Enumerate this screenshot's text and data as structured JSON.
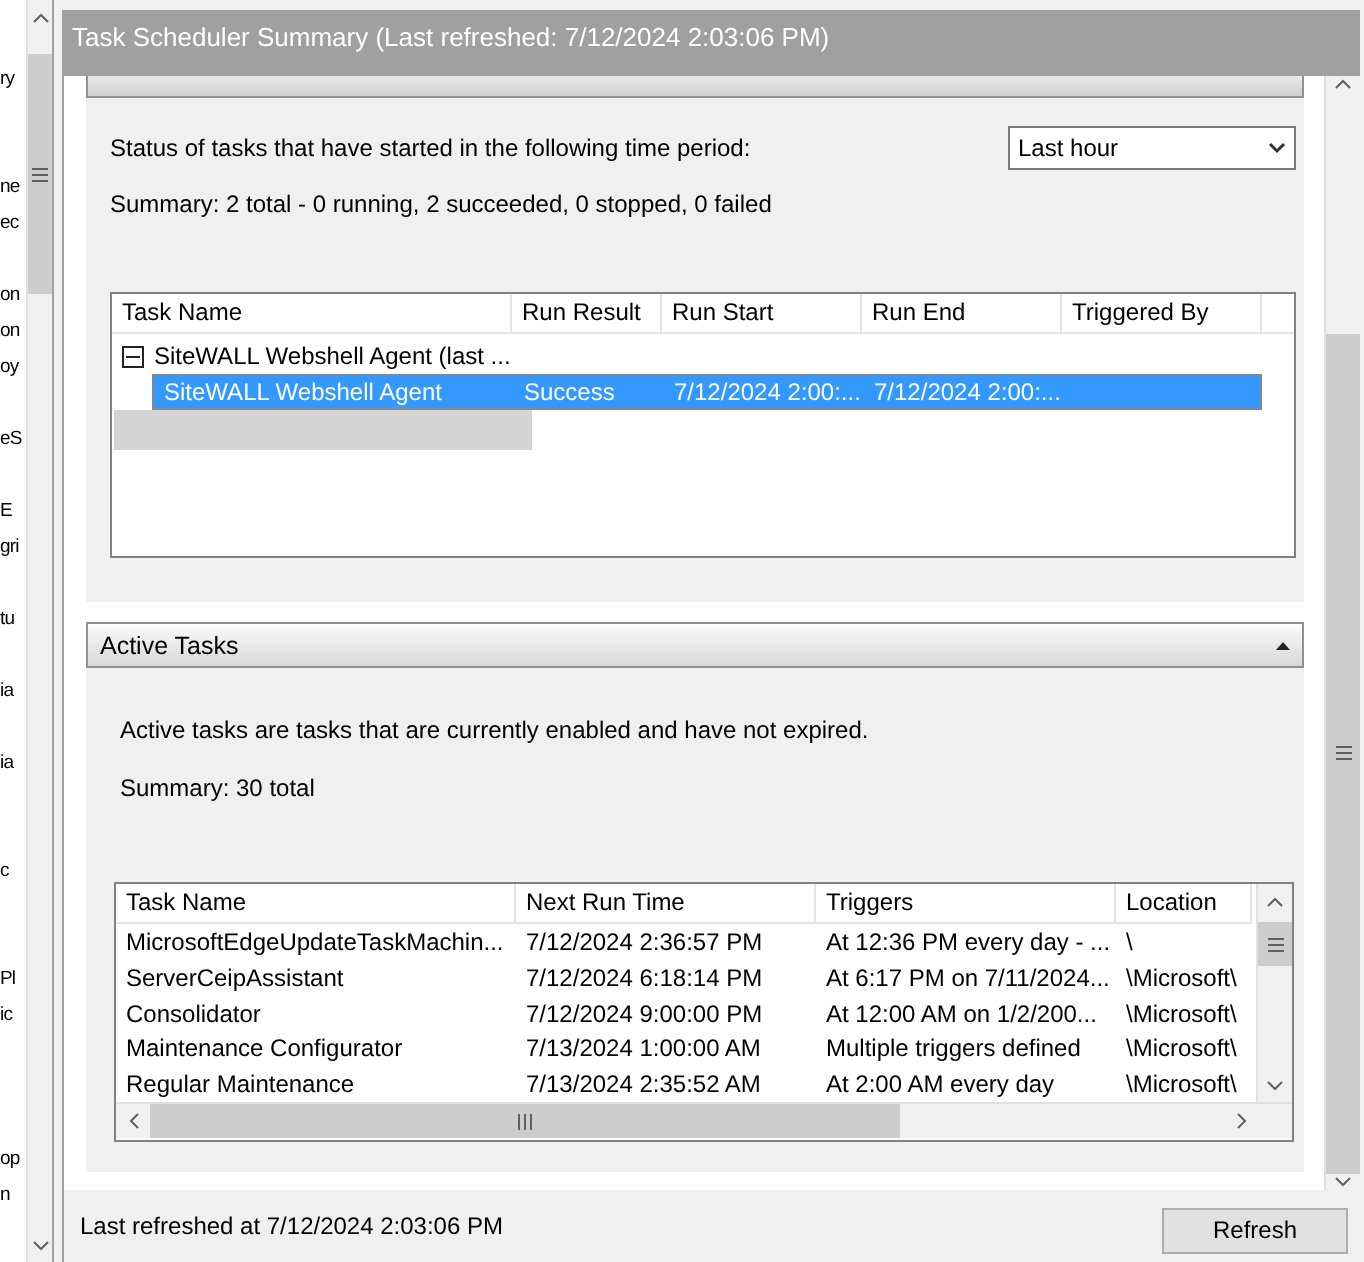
{
  "left_pane": {
    "fragments": [
      "ry",
      "ne",
      "ec",
      "on",
      "on",
      "oy",
      "eS",
      "E",
      "gri",
      "tu",
      "ia",
      "ia",
      "c",
      "Pl",
      "ic",
      "op",
      "n"
    ]
  },
  "panel": {
    "title": "Task Scheduler Summary (Last refreshed: 7/12/2024 2:03:06 PM)"
  },
  "task_status": {
    "prompt": "Status of tasks that have started in the following time period:",
    "period": "Last hour",
    "summary": "Summary: 2 total - 0 running, 2 succeeded, 0 stopped, 0 failed",
    "table": {
      "columns": [
        "Task Name",
        "Run Result",
        "Run Start",
        "Run End",
        "Triggered By"
      ],
      "groups": [
        {
          "label": "SiteWALL Webshell Agent (last ...",
          "expanded": true,
          "rows": [
            {
              "cells": [
                "SiteWALL Webshell Agent",
                "Success",
                "7/12/2024 2:00:...",
                "7/12/2024 2:00:..."
              ],
              "selected": true
            }
          ]
        }
      ]
    }
  },
  "active_tasks": {
    "title": "Active Tasks",
    "expanded": true,
    "description": "Active tasks are tasks that are currently enabled and have not expired.",
    "summary": "Summary: 30 total",
    "table": {
      "columns": [
        "Task Name",
        "Next Run Time",
        "Triggers",
        "Location"
      ],
      "rows": [
        [
          "MicrosoftEdgeUpdateTaskMachin...",
          "7/12/2024 2:36:57 PM",
          "At 12:36 PM every day - ...",
          "\\"
        ],
        [
          "ServerCeipAssistant",
          "7/12/2024 6:18:14 PM",
          "At 6:17 PM on 7/11/2024...",
          "\\Microsoft\\"
        ],
        [
          "Consolidator",
          "7/12/2024 9:00:00 PM",
          "At 12:00 AM on 1/2/200...",
          "\\Microsoft\\"
        ],
        [
          "Maintenance Configurator",
          "7/13/2024 1:00:00 AM",
          "Multiple triggers defined",
          "\\Microsoft\\"
        ],
        [
          "Regular Maintenance",
          "7/13/2024 2:35:52 AM",
          "At 2:00 AM every day",
          "\\Microsoft\\"
        ]
      ]
    }
  },
  "footer": {
    "last_refreshed": "Last refreshed at 7/12/2024 2:03:06 PM",
    "button": "Refresh"
  }
}
